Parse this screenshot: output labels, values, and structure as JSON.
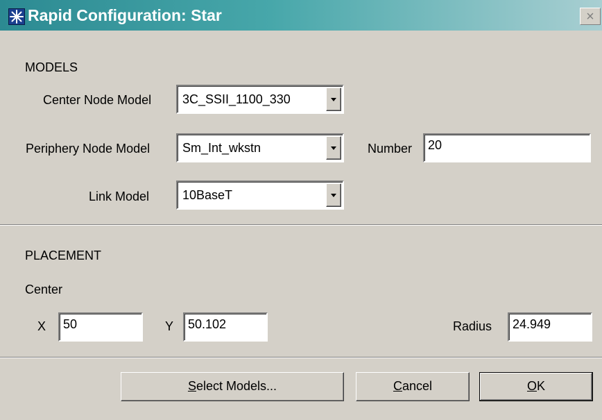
{
  "window": {
    "title": "Rapid Configuration: Star",
    "close_glyph": "×"
  },
  "models": {
    "heading": "MODELS",
    "center_node_label": "Center Node Model",
    "center_node_value": "3C_SSII_1100_330",
    "periphery_node_label": "Periphery Node Model",
    "periphery_node_value": "Sm_Int_wkstn",
    "number_label": "Number",
    "number_value": "20",
    "link_label": "Link Model",
    "link_value": "10BaseT"
  },
  "placement": {
    "heading": "PLACEMENT",
    "center_label": "Center",
    "x_label": "X",
    "x_value": "50",
    "y_label": "Y",
    "y_value": "50.102",
    "radius_label": "Radius",
    "radius_value": "24.949"
  },
  "buttons": {
    "select_models": {
      "mnemonic": "S",
      "rest": "elect Models..."
    },
    "cancel": {
      "mnemonic": "C",
      "rest": "ancel"
    },
    "ok": {
      "mnemonic": "O",
      "rest": "K"
    }
  },
  "icons": {
    "app": "star-burst-icon",
    "dropdown": "chevron-down-icon"
  },
  "colors": {
    "titlebar_start": "#2c8a92",
    "titlebar_end": "#a9cfd2",
    "dialog_bg": "#d4d0c8"
  }
}
